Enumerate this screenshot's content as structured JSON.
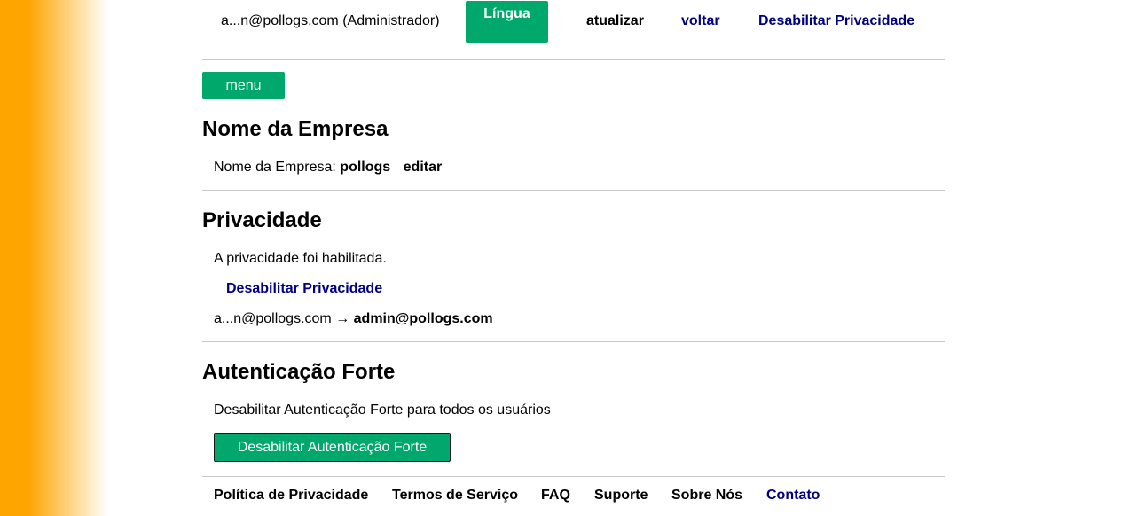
{
  "header": {
    "user": "a...n@pollogs.com (Administrador)",
    "language_button": "Língua",
    "refresh_link": "atualizar",
    "back_link": "voltar",
    "disable_privacy_link": "Desabilitar Privacidade"
  },
  "menu_button": "menu",
  "company": {
    "title": "Nome da Empresa",
    "label": "Nome da Empresa:",
    "value": "pollogs",
    "edit_link": "editar"
  },
  "privacy": {
    "title": "Privacidade",
    "status": "A privacidade foi habilitada.",
    "disable_link": "Desabilitar Privacidade",
    "mapping_masked": "a...n@pollogs.com",
    "mapping_arrow": "→",
    "mapping_real": "admin@pollogs.com"
  },
  "strong_auth": {
    "title": "Autenticação Forte",
    "description": "Desabilitar Autenticação Forte para todos os usuários",
    "button": "Desabilitar Autenticação Forte"
  },
  "footer": {
    "privacy_policy": "Política de Privacidade",
    "terms": "Termos de Serviço",
    "faq": "FAQ",
    "support": "Suporte",
    "about": "Sobre Nós",
    "contact": "Contato"
  },
  "colors": {
    "accent_green": "#00a86b",
    "link_navy": "#000080",
    "side_orange": "#ffa500"
  }
}
